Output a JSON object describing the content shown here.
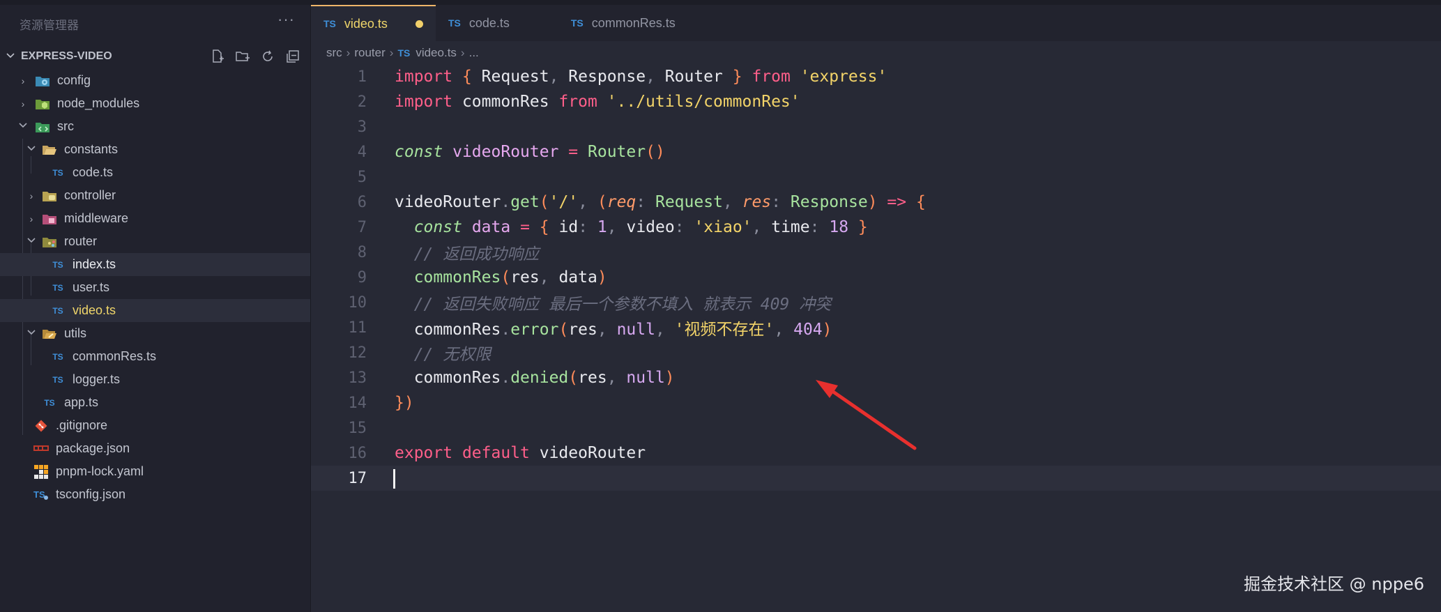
{
  "sidebar": {
    "title": "资源管理器",
    "more": "···",
    "project": "EXPRESS-VIDEO",
    "items": [
      {
        "label": "config",
        "type": "folder",
        "depth": 0,
        "open": false
      },
      {
        "label": "node_modules",
        "type": "folder",
        "depth": 0,
        "open": false
      },
      {
        "label": "src",
        "type": "folder",
        "depth": 0,
        "open": true
      },
      {
        "label": "constants",
        "type": "folder",
        "depth": 1,
        "open": true
      },
      {
        "label": "code.ts",
        "type": "ts",
        "depth": 2
      },
      {
        "label": "controller",
        "type": "folder",
        "depth": 1,
        "open": false
      },
      {
        "label": "middleware",
        "type": "folder",
        "depth": 1,
        "open": false
      },
      {
        "label": "router",
        "type": "folder",
        "depth": 1,
        "open": true
      },
      {
        "label": "index.ts",
        "type": "ts",
        "depth": 2
      },
      {
        "label": "user.ts",
        "type": "ts",
        "depth": 2
      },
      {
        "label": "video.ts",
        "type": "ts",
        "depth": 2
      },
      {
        "label": "utils",
        "type": "folder",
        "depth": 1,
        "open": true
      },
      {
        "label": "commonRes.ts",
        "type": "ts",
        "depth": 2
      },
      {
        "label": "logger.ts",
        "type": "ts",
        "depth": 2
      },
      {
        "label": "app.ts",
        "type": "ts",
        "depth": 1
      },
      {
        "label": ".gitignore",
        "type": "git",
        "depth": 0
      },
      {
        "label": "package.json",
        "type": "npm",
        "depth": 0
      },
      {
        "label": "pnpm-lock.yaml",
        "type": "pnpm",
        "depth": 0
      },
      {
        "label": "tsconfig.json",
        "type": "tsconfig",
        "depth": 0
      }
    ]
  },
  "tabs": [
    {
      "label": "video.ts",
      "icon": "TS",
      "active": true,
      "modified": true
    },
    {
      "label": "code.ts",
      "icon": "TS",
      "active": false
    },
    {
      "label": "commonRes.ts",
      "icon": "TS",
      "active": false
    }
  ],
  "breadcrumb": {
    "parts": [
      "src",
      "router"
    ],
    "icon": "TS",
    "file": "video.ts",
    "tail": "..."
  },
  "code": {
    "current_line": 17,
    "lines": [
      [
        [
          "kw",
          "import"
        ],
        [
          "t",
          " "
        ],
        [
          "br",
          "{"
        ],
        [
          "t",
          " Request"
        ],
        [
          "pun",
          ","
        ],
        [
          "t",
          " Response"
        ],
        [
          "pun",
          ","
        ],
        [
          "t",
          " Router "
        ],
        [
          "br",
          "}"
        ],
        [
          "t",
          " "
        ],
        [
          "kw",
          "from"
        ],
        [
          "t",
          " "
        ],
        [
          "str",
          "'express'"
        ]
      ],
      [
        [
          "kw",
          "import"
        ],
        [
          "t",
          " commonRes "
        ],
        [
          "kw",
          "from"
        ],
        [
          "t",
          " "
        ],
        [
          "str",
          "'../utils/commonRes'"
        ]
      ],
      [],
      [
        [
          "constk",
          "const"
        ],
        [
          "t",
          " "
        ],
        [
          "var",
          "videoRouter"
        ],
        [
          "t",
          " "
        ],
        [
          "op",
          "="
        ],
        [
          "t",
          " "
        ],
        [
          "fn",
          "Router"
        ],
        [
          "br",
          "()"
        ]
      ],
      [],
      [
        [
          "t",
          "videoRouter"
        ],
        [
          "pun",
          "."
        ],
        [
          "fn",
          "get"
        ],
        [
          "br",
          "("
        ],
        [
          "str",
          "'/'"
        ],
        [
          "pun",
          ","
        ],
        [
          "t",
          " "
        ],
        [
          "br",
          "("
        ],
        [
          "prm",
          "req"
        ],
        [
          "pun",
          ":"
        ],
        [
          "t",
          " "
        ],
        [
          "typ",
          "Request"
        ],
        [
          "pun",
          ","
        ],
        [
          "t",
          " "
        ],
        [
          "prm",
          "res"
        ],
        [
          "pun",
          ":"
        ],
        [
          "t",
          " "
        ],
        [
          "typ",
          "Response"
        ],
        [
          "br",
          ")"
        ],
        [
          "t",
          " "
        ],
        [
          "op",
          "=>"
        ],
        [
          "t",
          " "
        ],
        [
          "br",
          "{"
        ]
      ],
      [
        [
          "t",
          "  "
        ],
        [
          "constk",
          "const"
        ],
        [
          "t",
          " "
        ],
        [
          "var",
          "data"
        ],
        [
          "t",
          " "
        ],
        [
          "op",
          "="
        ],
        [
          "t",
          " "
        ],
        [
          "br",
          "{"
        ],
        [
          "t",
          " id"
        ],
        [
          "pun",
          ":"
        ],
        [
          "t",
          " "
        ],
        [
          "num",
          "1"
        ],
        [
          "pun",
          ","
        ],
        [
          "t",
          " video"
        ],
        [
          "pun",
          ":"
        ],
        [
          "t",
          " "
        ],
        [
          "str",
          "'xiao'"
        ],
        [
          "pun",
          ","
        ],
        [
          "t",
          " time"
        ],
        [
          "pun",
          ":"
        ],
        [
          "t",
          " "
        ],
        [
          "num",
          "18"
        ],
        [
          "t",
          " "
        ],
        [
          "br",
          "}"
        ]
      ],
      [
        [
          "t",
          "  "
        ],
        [
          "cmt",
          "// 返回成功响应"
        ]
      ],
      [
        [
          "t",
          "  "
        ],
        [
          "fn",
          "commonRes"
        ],
        [
          "br",
          "("
        ],
        [
          "t",
          "res"
        ],
        [
          "pun",
          ","
        ],
        [
          "t",
          " data"
        ],
        [
          "br",
          ")"
        ]
      ],
      [
        [
          "t",
          "  "
        ],
        [
          "cmt",
          "// 返回失败响应 最后一个参数不填入 就表示 409 冲突"
        ]
      ],
      [
        [
          "t",
          "  commonRes"
        ],
        [
          "pun",
          "."
        ],
        [
          "fn",
          "error"
        ],
        [
          "br",
          "("
        ],
        [
          "t",
          "res"
        ],
        [
          "pun",
          ","
        ],
        [
          "t",
          " "
        ],
        [
          "nul",
          "null"
        ],
        [
          "pun",
          ","
        ],
        [
          "t",
          " "
        ],
        [
          "str",
          "'视频不存在'"
        ],
        [
          "pun",
          ","
        ],
        [
          "t",
          " "
        ],
        [
          "num",
          "404"
        ],
        [
          "br",
          ")"
        ]
      ],
      [
        [
          "t",
          "  "
        ],
        [
          "cmt",
          "// 无权限"
        ]
      ],
      [
        [
          "t",
          "  commonRes"
        ],
        [
          "pun",
          "."
        ],
        [
          "fn",
          "denied"
        ],
        [
          "br",
          "("
        ],
        [
          "t",
          "res"
        ],
        [
          "pun",
          ","
        ],
        [
          "t",
          " "
        ],
        [
          "nul",
          "null"
        ],
        [
          "br",
          ")"
        ]
      ],
      [
        [
          "br",
          "})"
        ]
      ],
      [],
      [
        [
          "kw",
          "export"
        ],
        [
          "t",
          " "
        ],
        [
          "kw",
          "default"
        ],
        [
          "t",
          " videoRouter"
        ]
      ],
      []
    ]
  },
  "watermark": "掘金技术社区 @ nppe6",
  "colors": {
    "accent": "#f0d66a",
    "arrow": "#e8302e",
    "ts_icon": "#3f8fd8"
  }
}
